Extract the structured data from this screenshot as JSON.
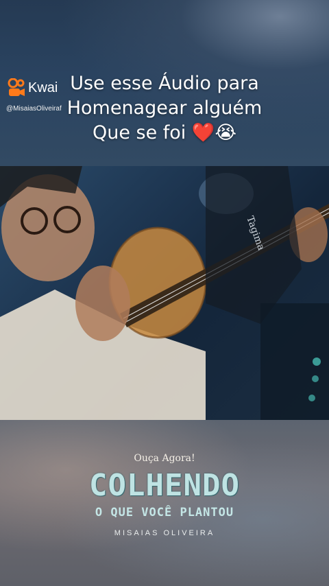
{
  "overlay": {
    "caption_lines": [
      "Use esse Áudio para",
      "Homenagear alguém",
      "Que se foi ❤️😭"
    ],
    "app_logo_text": "Kwai",
    "handle": "@MisaiasOliveiraf"
  },
  "video": {
    "icon": "video-frame-icon",
    "guitar_brand": "Tagima"
  },
  "promo": {
    "tagline": "Ouça Agora!",
    "title": "COLHENDO",
    "subtitle": "O QUE VOCÊ PLANTOU",
    "artist": "MISAIAS OLIVEIRA"
  },
  "colors": {
    "background_top": "#253a53",
    "background_bottom": "#5e6068",
    "title_color": "#bfe3e3",
    "kwai_orange": "#ff7a1a"
  }
}
